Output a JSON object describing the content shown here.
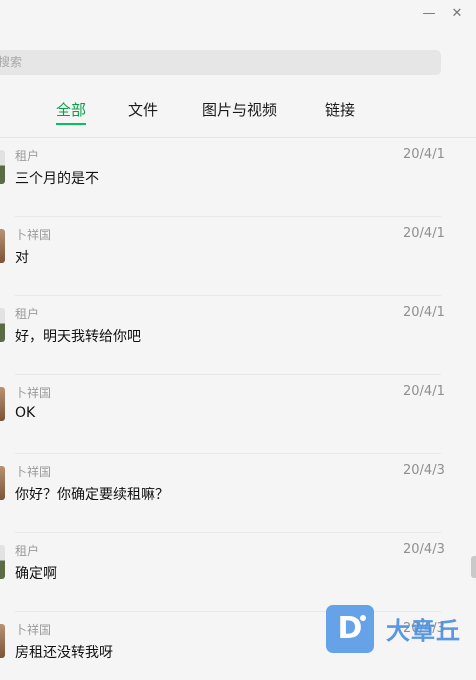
{
  "window": {
    "minimize_label": "—",
    "close_label": "✕"
  },
  "search": {
    "placeholder": "搜索"
  },
  "tabs": [
    {
      "label": "全部",
      "active": true
    },
    {
      "label": "文件",
      "active": false
    },
    {
      "label": "图片与视频",
      "active": false
    },
    {
      "label": "链接",
      "active": false
    }
  ],
  "messages": [
    {
      "sender": "租户",
      "date": "20/4/1",
      "text": "三个月的是不",
      "avatar": "tenant"
    },
    {
      "sender": "卜祥国",
      "date": "20/4/1",
      "text": "对",
      "avatar": "landlord"
    },
    {
      "sender": "租户",
      "date": "20/4/1",
      "text": "好，明天我转给你吧",
      "avatar": "tenant"
    },
    {
      "sender": "卜祥国",
      "date": "20/4/1",
      "text": "OK",
      "avatar": "landlord"
    },
    {
      "sender": "卜祥国",
      "date": "20/4/3",
      "text": "你好？你确定要续租嘛？",
      "avatar": "landlord"
    },
    {
      "sender": "租户",
      "date": "20/4/3",
      "text": "确定啊",
      "avatar": "tenant"
    },
    {
      "sender": "卜祥国",
      "date": "20/4/3",
      "text": "房租还没转我呀",
      "avatar": "landlord"
    }
  ],
  "watermark": {
    "logo_letter": "D",
    "text": "大章丘"
  },
  "colors": {
    "accent": "#07c160",
    "background": "#f5f5f5",
    "watermark": "#4d90e0"
  }
}
